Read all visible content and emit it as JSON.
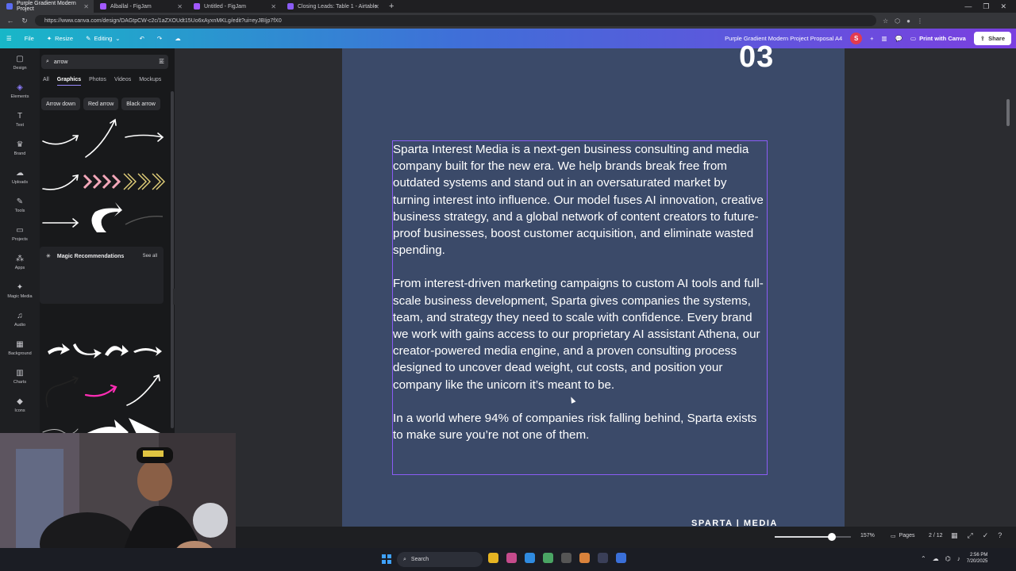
{
  "browser": {
    "tabs": [
      {
        "title": "Purple Gradient Modern Project",
        "color": "#5b6cf2",
        "active": true
      },
      {
        "title": "Alballal - FigJam",
        "color": "#a259ff",
        "active": false
      },
      {
        "title": "Untitled - FigJam",
        "color": "#a259ff",
        "active": false
      },
      {
        "title": "Closing Leads: Table 1 - Airtable",
        "color": "#8a5cf5",
        "active": false
      }
    ],
    "new_tab": "+",
    "url": "https://www.canva.com/design/DAGtpCW-c2c/1aZXOUdt15Uo6xAyxnMKLg/edit?ui=eyJBIjp7fX0"
  },
  "canva_toolbar": {
    "file": "File",
    "resize": "Resize",
    "editing": "Editing",
    "doc_title": "Purple Gradient Modern Project Proposal A4",
    "avatar_letter": "S",
    "add": "+",
    "print": "Print with Canva",
    "share": "Share"
  },
  "left_rail": [
    {
      "label": "Design",
      "icon": "design-icon",
      "glyph": "▢"
    },
    {
      "label": "Elements",
      "icon": "elements-icon",
      "glyph": "◈"
    },
    {
      "label": "Text",
      "icon": "text-icon",
      "glyph": "T"
    },
    {
      "label": "Brand",
      "icon": "brand-icon",
      "glyph": "♛"
    },
    {
      "label": "Uploads",
      "icon": "uploads-icon",
      "glyph": "☁"
    },
    {
      "label": "Tools",
      "icon": "tools-icon",
      "glyph": "✎"
    },
    {
      "label": "Projects",
      "icon": "projects-icon",
      "glyph": "▭"
    },
    {
      "label": "Apps",
      "icon": "apps-icon",
      "glyph": "⁂"
    },
    {
      "label": "Magic Media",
      "icon": "magic-media-icon",
      "glyph": "✦"
    },
    {
      "label": "Audio",
      "icon": "audio-icon",
      "glyph": "♫"
    },
    {
      "label": "Background",
      "icon": "background-icon",
      "glyph": "▦"
    },
    {
      "label": "Charts",
      "icon": "charts-icon",
      "glyph": "▥"
    },
    {
      "label": "Icons",
      "icon": "icons-icon",
      "glyph": "◆"
    }
  ],
  "panel": {
    "search_value": "arrow",
    "tabs": [
      "All",
      "Graphics",
      "Photos",
      "Videos",
      "Mockups"
    ],
    "active_tab": "Graphics",
    "chips": [
      "Arrow down",
      "Red arrow",
      "Black arrow"
    ],
    "magic_title": "Magic Recommendations",
    "see_all": "See all"
  },
  "page": {
    "number": "03",
    "paragraphs": [
      "Sparta Interest Media is a next-gen business consulting and media company built for the new era. We help brands break free from outdated systems and stand out in an oversaturated market by turning interest into influence. Our model fuses AI innovation, creative business strategy, and a global network of content creators to future-proof businesses, boost customer acquisition, and eliminate wasted spending.",
      "From interest-driven marketing campaigns to custom AI tools and full-scale business development, Sparta gives companies the systems, team, and strategy they need to scale with confidence. Every brand we work with gains access to our proprietary AI assistant Athena, our creator-powered media engine, and a proven consulting process designed to uncover dead weight, cut costs, and position your company like the unicorn it’s meant to be.",
      "In a world where 94% of companies risk falling behind, Sparta exists to make sure you’re not one of them."
    ],
    "footer": "SPARTA | MEDIA"
  },
  "bottom_bar": {
    "zoom_fraction": 0.75,
    "zoom_label": "157%",
    "pages_label": "Pages",
    "page_count": "2 / 12"
  },
  "taskbar": {
    "search": "Search",
    "time": "2:56 PM",
    "date": "7/20/2025"
  }
}
